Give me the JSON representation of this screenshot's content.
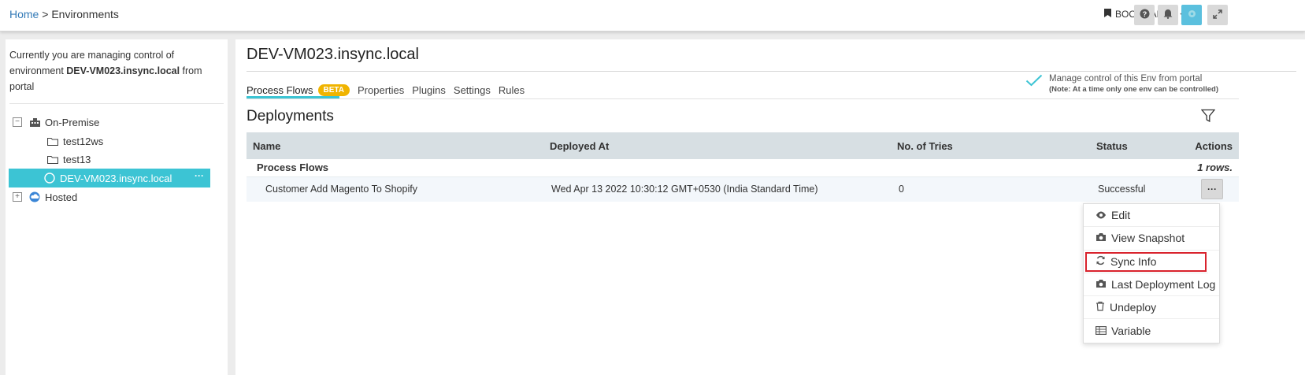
{
  "breadcrumb": {
    "home": "Home",
    "separator": ">",
    "current": "Environments"
  },
  "topbar": {
    "bookmarks_label": "BOOKMARKS"
  },
  "left_panel": {
    "managing_prefix": "Currently you are managing control of environment ",
    "managing_env": "DEV-VM023.insync.local",
    "managing_suffix": " from portal",
    "tree": {
      "on_premise": "On-Premise",
      "folders": [
        "test12ws",
        "test13"
      ],
      "selected_env": "DEV-VM023.insync.local",
      "hosted": "Hosted"
    }
  },
  "main": {
    "env_title": "DEV-VM023.insync.local",
    "tabs": {
      "process_flows": "Process Flows",
      "beta": "BETA",
      "properties": "Properties",
      "plugins": "Plugins",
      "settings": "Settings",
      "rules": "Rules"
    },
    "manage_control": {
      "label": "Manage control of this Env from portal",
      "note": "(Note: At a time only one env can be controlled)"
    },
    "section_title": "Deployments",
    "table": {
      "headers": {
        "name": "Name",
        "deployed_at": "Deployed At",
        "tries": "No. of Tries",
        "status": "Status",
        "actions": "Actions"
      },
      "group": {
        "label": "Process Flows",
        "count": "1 rows."
      },
      "rows": [
        {
          "name": "Customer Add Magento To Shopify",
          "deployed_at": "Wed Apr 13 2022 10:30:12 GMT+0530 (India Standard Time)",
          "tries": "0",
          "status": "Successful"
        }
      ]
    }
  },
  "actions_menu": {
    "edit": "Edit",
    "view_snapshot": "View Snapshot",
    "sync_info": "Sync Info",
    "last_log": "Last Deployment Log",
    "undeploy": "Undeploy",
    "variable": "Variable"
  },
  "colors": {
    "accent": "#3cc4d4",
    "link": "#337ab7",
    "beta": "#f0b400",
    "highlight": "#d9232d"
  }
}
